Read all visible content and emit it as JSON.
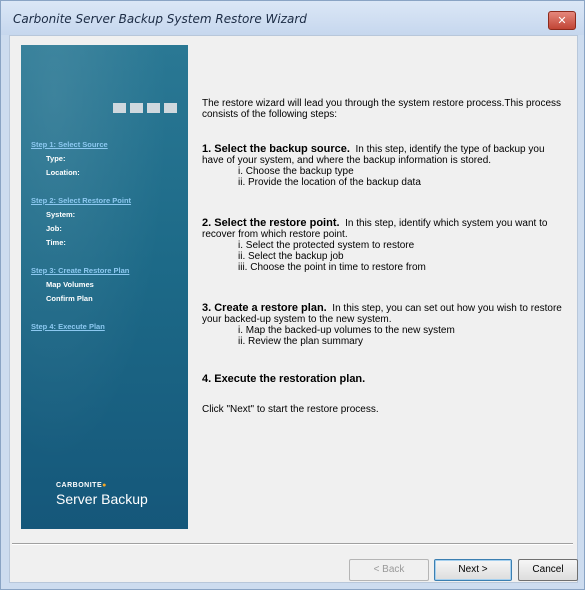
{
  "window": {
    "title": "Carbonite Server Backup System Restore Wizard",
    "close_symbol": "✕"
  },
  "sidebar": {
    "steps": [
      {
        "label": "Step 1: Select Source",
        "subitems": [
          "Type:",
          "Location:"
        ]
      },
      {
        "label": "Step 2: Select Restore Point",
        "subitems": [
          "System:",
          "Job:",
          "Time:"
        ]
      },
      {
        "label": "Step 3: Create Restore Plan",
        "subitems": [
          "Map Volumes",
          "Confirm Plan"
        ]
      },
      {
        "label": "Step 4: Execute Plan",
        "subitems": []
      }
    ],
    "brand_small": "CARBONITE",
    "brand_dot": "●",
    "brand_big": "Server Backup"
  },
  "content": {
    "intro": "The restore wizard will lead you through the system restore process.This process consists of the following steps:",
    "sections": [
      {
        "heading": "1. Select the backup source.",
        "text": "In this step, identify the type of backup you have of your system, and where the backup information is stored.",
        "items": [
          "i.  Choose the  backup type",
          "ii.  Provide the location of the backup data"
        ]
      },
      {
        "heading": "2. Select the restore point.",
        "text": "In this step, identify which system you want  to recover from  which restore point.",
        "items": [
          "i.  Select the protected system to restore",
          "ii. Select the backup job",
          "iii. Choose the point in time to restore from"
        ]
      },
      {
        "heading": "3. Create a restore plan.",
        "text": "In this step, you can set out how you wish to restore your backed-up system to the new system.",
        "items": [
          "i.  Map the backed-up volumes to the new system",
          "ii. Review the plan summary"
        ]
      },
      {
        "heading": "4. Execute the restoration plan.",
        "text": "",
        "items": []
      }
    ],
    "closing": "Click \"Next\" to start the restore process."
  },
  "buttons": {
    "back": "< Back",
    "next": "Next >",
    "cancel": "Cancel"
  }
}
